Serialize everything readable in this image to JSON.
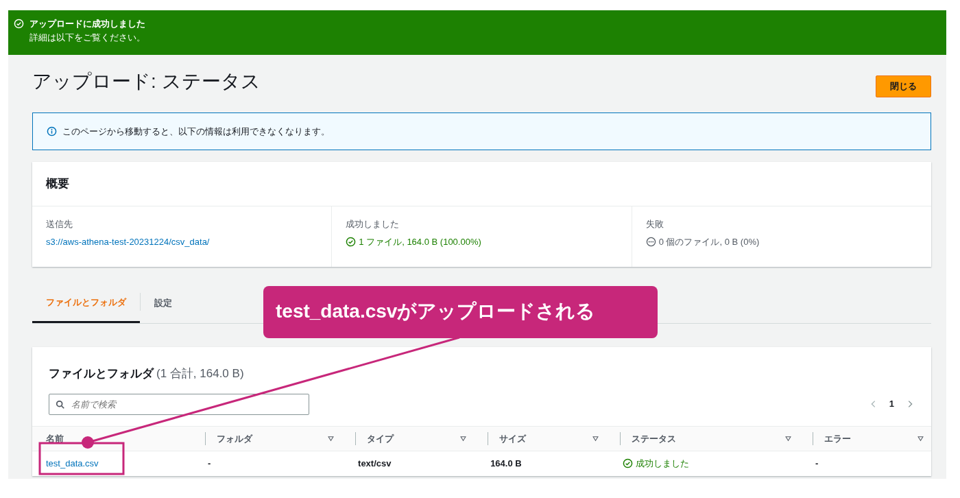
{
  "flash": {
    "title": "アップロードに成功しました",
    "message": "詳細は以下をご覧ください。"
  },
  "page": {
    "title": "アップロード: ステータス",
    "close_button": "閉じる"
  },
  "info_alert": "このページから移動すると、以下の情報は利用できなくなります。",
  "summary": {
    "title": "概要",
    "columns": [
      {
        "label": "送信先",
        "value": "s3://aws-athena-test-20231224/csv_data/",
        "kind": "link"
      },
      {
        "label": "成功しました",
        "value": "1 ファイル, 164.0 B (100.00%)",
        "kind": "success"
      },
      {
        "label": "失敗",
        "value": "0 個のファイル, 0 B (0%)",
        "kind": "neutral"
      }
    ]
  },
  "tabs": [
    {
      "label": "ファイルとフォルダ",
      "selected": true
    },
    {
      "label": "設定",
      "selected": false
    }
  ],
  "files": {
    "title": "ファイルとフォルダ",
    "count": "(1 合計, 164.0 B)",
    "search": {
      "placeholder": "名前で検索"
    },
    "pagination": {
      "page": "1"
    },
    "table": {
      "columns": [
        {
          "label": "名前",
          "sortable": false
        },
        {
          "label": "フォルダ",
          "sortable": true
        },
        {
          "label": "タイプ",
          "sortable": true
        },
        {
          "label": "サイズ",
          "sortable": true
        },
        {
          "label": "ステータス",
          "sortable": true
        },
        {
          "label": "エラー",
          "sortable": true
        }
      ],
      "rows": [
        [
          {
            "text": "test_data.csv",
            "kind": "link"
          },
          {
            "text": "-",
            "kind": "text"
          },
          {
            "text": "text/csv",
            "kind": "text"
          },
          {
            "text": "164.0 B",
            "kind": "text"
          },
          {
            "text": "成功しました",
            "kind": "success"
          },
          {
            "text": "-",
            "kind": "text"
          }
        ]
      ]
    }
  },
  "annotation": {
    "text": "test_data.csvがアップロードされる"
  }
}
